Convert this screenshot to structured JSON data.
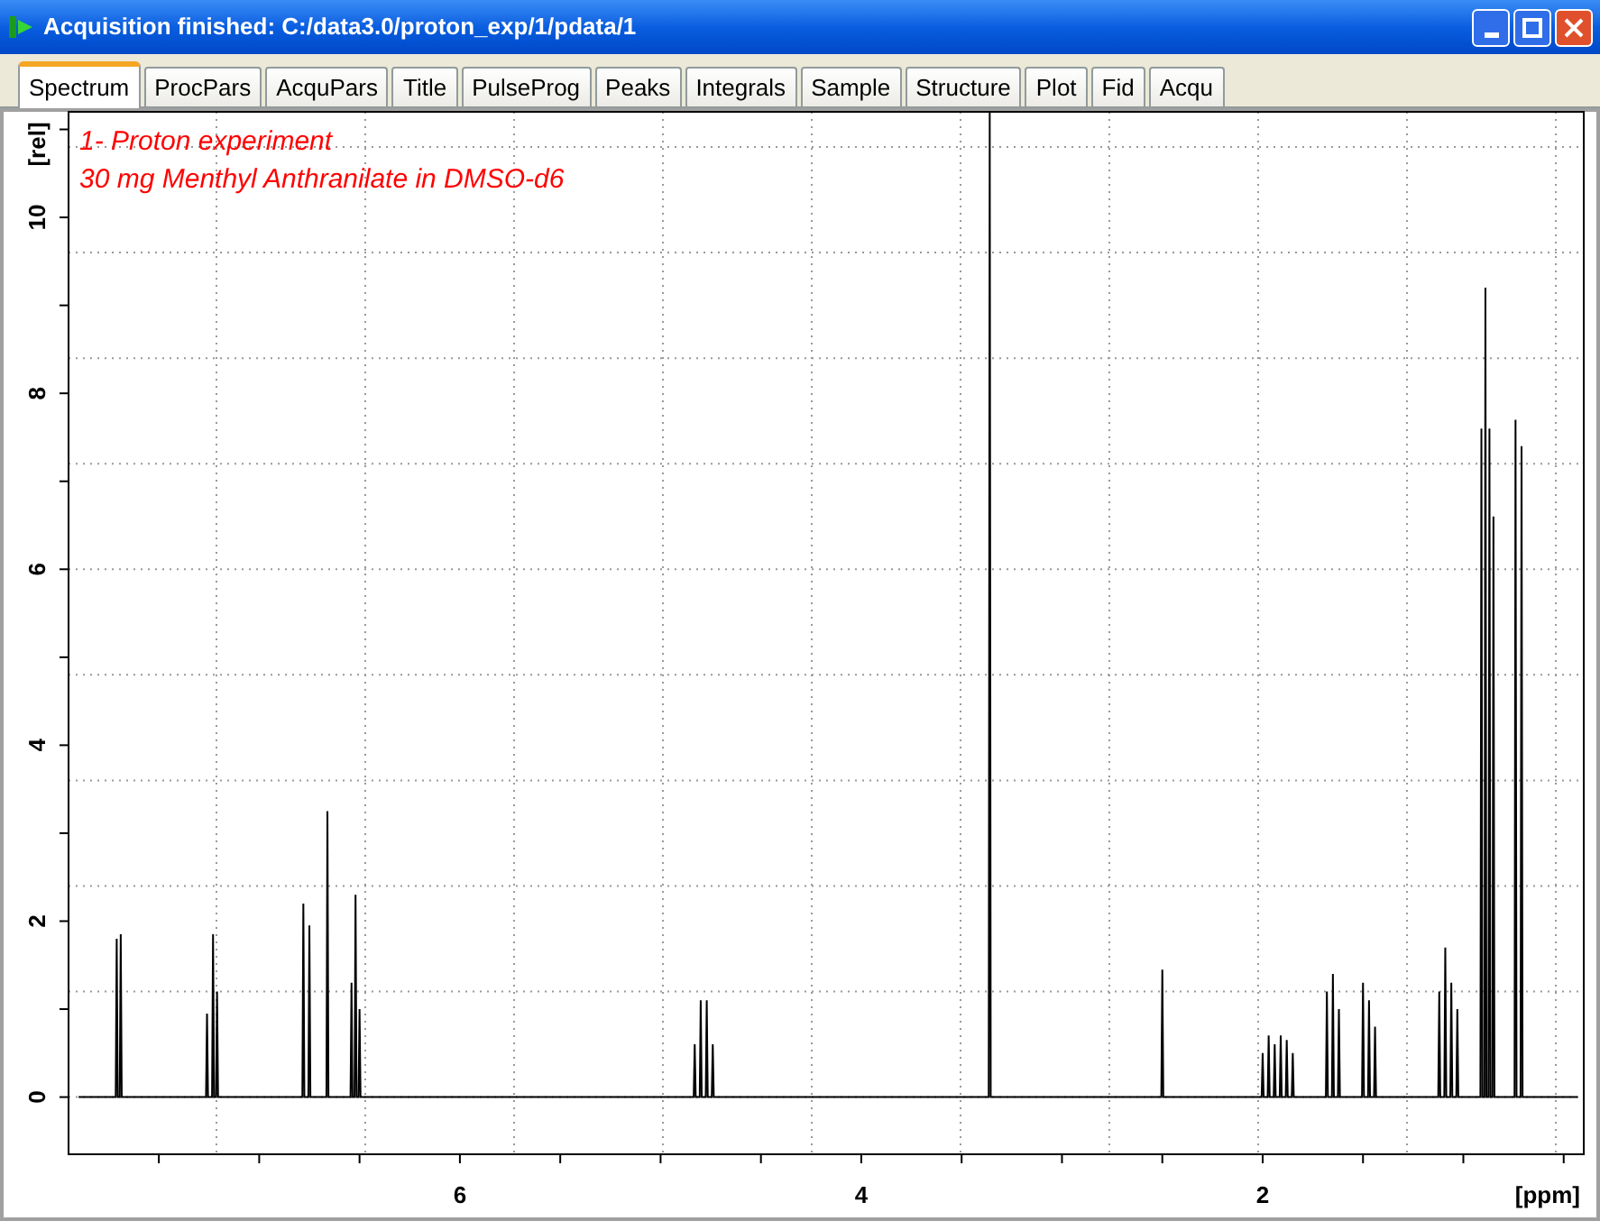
{
  "window": {
    "title": "Acquisition finished: C:/data3.0/proton_exp/1/pdata/1"
  },
  "tabs": [
    {
      "label": "Spectrum",
      "selected": true
    },
    {
      "label": "ProcPars",
      "selected": false
    },
    {
      "label": "AcquPars",
      "selected": false
    },
    {
      "label": "Title",
      "selected": false
    },
    {
      "label": "PulseProg",
      "selected": false
    },
    {
      "label": "Peaks",
      "selected": false
    },
    {
      "label": "Integrals",
      "selected": false
    },
    {
      "label": "Sample",
      "selected": false
    },
    {
      "label": "Structure",
      "selected": false
    },
    {
      "label": "Plot",
      "selected": false
    },
    {
      "label": "Fid",
      "selected": false
    },
    {
      "label": "Acqu",
      "selected": false
    }
  ],
  "spectrum": {
    "title_lines": [
      "1- Proton experiment",
      "30 mg Menthyl Anthranilate in DMSO-d6"
    ],
    "chart_data": {
      "type": "line",
      "xlabel": "[ppm]",
      "ylabel": "[rel]",
      "xlim": [
        7.95,
        0.4
      ],
      "ylim": [
        -0.65,
        11.2
      ],
      "grid": true,
      "xticks": [
        6,
        4,
        2
      ],
      "yticks": [
        0,
        2,
        4,
        6,
        8,
        10
      ],
      "series": [
        {
          "color": "#000000",
          "x": [
            7.9,
            7.715,
            7.71,
            7.705,
            7.695,
            7.69,
            7.685,
            7.265,
            7.26,
            7.255,
            7.235,
            7.23,
            7.225,
            7.215,
            7.21,
            7.205,
            6.785,
            6.78,
            6.775,
            6.755,
            6.75,
            6.745,
            6.665,
            6.66,
            6.655,
            6.545,
            6.54,
            6.535,
            6.525,
            6.52,
            6.515,
            6.505,
            6.5,
            6.495,
            4.835,
            4.83,
            4.825,
            4.805,
            4.8,
            4.795,
            4.775,
            4.77,
            4.765,
            4.745,
            4.74,
            4.735,
            3.365,
            3.36,
            3.355,
            2.505,
            2.5,
            2.495,
            2.005,
            2.0,
            1.995,
            1.975,
            1.97,
            1.965,
            1.945,
            1.94,
            1.935,
            1.915,
            1.91,
            1.905,
            1.885,
            1.88,
            1.875,
            1.855,
            1.85,
            1.845,
            1.685,
            1.68,
            1.675,
            1.655,
            1.65,
            1.645,
            1.625,
            1.62,
            1.615,
            1.505,
            1.5,
            1.495,
            1.475,
            1.47,
            1.465,
            1.445,
            1.44,
            1.435,
            1.125,
            1.12,
            1.115,
            1.095,
            1.09,
            1.085,
            1.065,
            1.06,
            1.055,
            1.035,
            1.03,
            1.025,
            0.915,
            0.91,
            0.905,
            0.895,
            0.89,
            0.885,
            0.875,
            0.87,
            0.865,
            0.855,
            0.85,
            0.845,
            0.745,
            0.74,
            0.735,
            0.715,
            0.71,
            0.705,
            0.43
          ],
          "values": [
            0,
            0,
            1.8,
            0,
            0,
            1.85,
            0,
            0,
            0.95,
            0,
            0,
            1.85,
            0,
            0,
            1.2,
            0,
            0,
            2.2,
            0,
            0,
            1.95,
            0,
            0,
            3.25,
            0,
            0,
            1.3,
            0,
            0,
            2.3,
            0,
            0,
            1.0,
            0,
            0,
            0.6,
            0,
            0,
            1.1,
            0,
            0,
            1.1,
            0,
            0,
            0.6,
            0,
            0,
            11.2,
            0,
            0,
            1.45,
            0,
            0,
            0.5,
            0,
            0,
            0.7,
            0,
            0,
            0.6,
            0,
            0,
            0.7,
            0,
            0,
            0.65,
            0,
            0,
            0.5,
            0,
            0,
            1.2,
            0,
            0,
            1.4,
            0,
            0,
            1.0,
            0,
            0,
            1.3,
            0,
            0,
            1.1,
            0,
            0,
            0.8,
            0,
            0,
            1.2,
            0,
            0,
            1.7,
            0,
            0,
            1.3,
            0,
            0,
            1.0,
            0,
            0,
            7.6,
            0,
            0,
            9.2,
            0,
            0,
            7.6,
            0,
            0,
            6.6,
            0,
            0,
            7.7,
            0,
            0,
            7.4,
            0,
            0
          ]
        }
      ]
    }
  }
}
